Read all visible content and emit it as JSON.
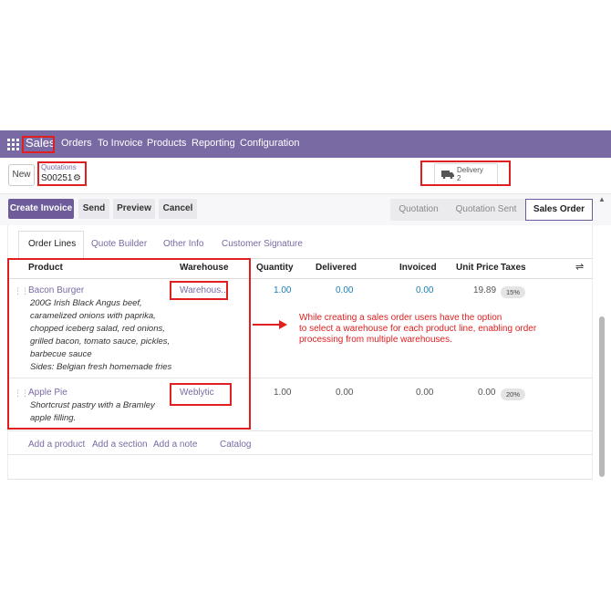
{
  "navbar": {
    "brand": "Sales",
    "items": [
      "Orders",
      "To Invoice",
      "Products",
      "Reporting",
      "Configuration"
    ]
  },
  "control": {
    "new_label": "New",
    "breadcrumb_parent": "Quotations",
    "breadcrumb_current": "S00251",
    "delivery_label": "Delivery",
    "delivery_count": "2"
  },
  "actions": {
    "create_invoice": "Create Invoice",
    "send": "Send",
    "preview": "Preview",
    "cancel": "Cancel"
  },
  "status": [
    "Quotation",
    "Quotation Sent",
    "Sales Order"
  ],
  "tabs": [
    "Order Lines",
    "Quote Builder",
    "Other Info",
    "Customer Signature"
  ],
  "columns": {
    "product": "Product",
    "warehouse": "Warehouse",
    "quantity": "Quantity",
    "delivered": "Delivered",
    "invoiced": "Invoiced",
    "unit_price": "Unit Price",
    "taxes": "Taxes"
  },
  "lines": [
    {
      "product": "Bacon Burger",
      "description": [
        "200G Irish Black Angus beef,",
        "caramelized onions with paprika,",
        "chopped iceberg salad, red onions,",
        "grilled bacon, tomato sauce, pickles,",
        "barbecue sauce",
        "Sides: Belgian fresh homemade fries"
      ],
      "warehouse": "Warehous...",
      "quantity": "1.00",
      "delivered": "0.00",
      "invoiced": "0.00",
      "unit_price": "19.89",
      "tax": "15%"
    },
    {
      "product": "Apple Pie",
      "description": [
        "Shortcrust pastry with a Bramley",
        "apple filling."
      ],
      "warehouse": "Weblytic",
      "quantity": "1.00",
      "delivered": "0.00",
      "invoiced": "0.00",
      "unit_price": "0.00",
      "tax": "20%"
    }
  ],
  "add_links": [
    "Add a product",
    "Add a section",
    "Add a note",
    "Catalog"
  ],
  "annotation": {
    "lines": [
      "While creating a sales order users have the option",
      "to select a warehouse for each product line, enabling order",
      "processing from multiple warehouses."
    ]
  },
  "colors": {
    "navbar": "#7a6aa3",
    "primary": "#6e5c9a",
    "annotation": "#e02020",
    "link_blue": "#1a7fb0"
  }
}
